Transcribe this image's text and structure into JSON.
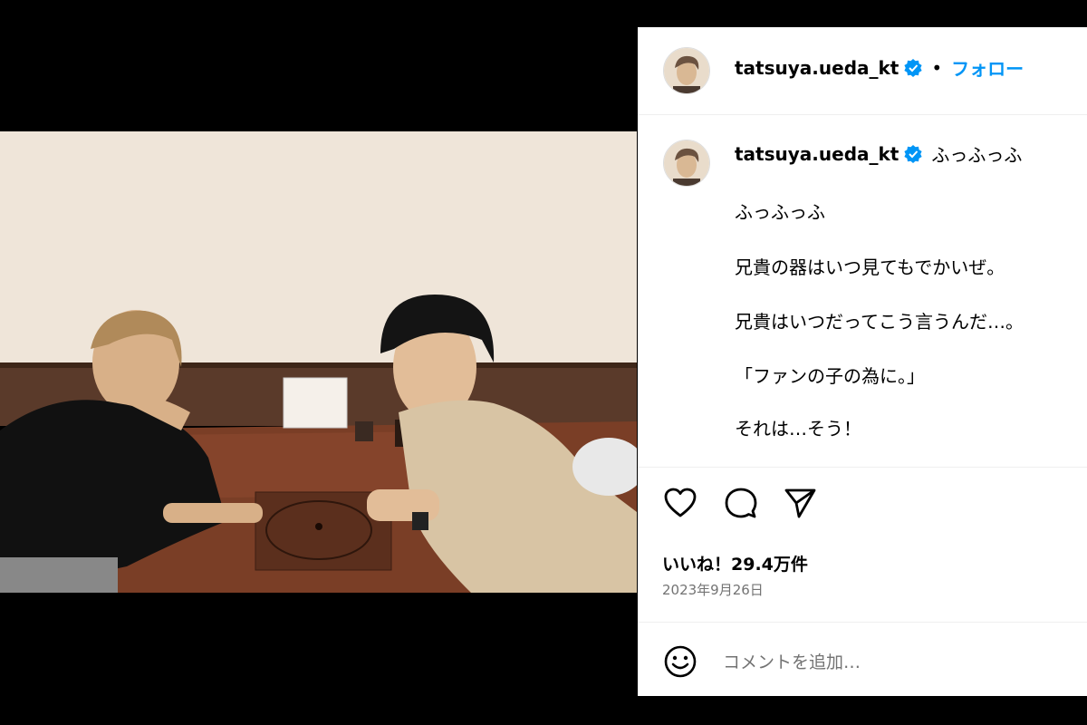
{
  "post": {
    "username": "tatsuya.ueda_kt",
    "verified": true,
    "separator": "•",
    "follow_label": "フォロー"
  },
  "caption": {
    "first_line": "ふっふっふ",
    "lines": [
      "ふっふっふ",
      "兄貴の器はいつ見てもでかいぜ。",
      "兄貴はいつだってこう言うんだ…。",
      "「ファンの子の為に。」",
      "それは…そう！"
    ]
  },
  "actions": {
    "icons": [
      "heart-icon",
      "comment-icon",
      "share-icon"
    ]
  },
  "stats": {
    "likes": "いいね！29.4万件",
    "date": "2023年9月26日"
  },
  "comment_box": {
    "placeholder": "コメントを追加…"
  },
  "colors": {
    "accent": "#0095f6",
    "muted": "#737373",
    "background": "#000000"
  }
}
